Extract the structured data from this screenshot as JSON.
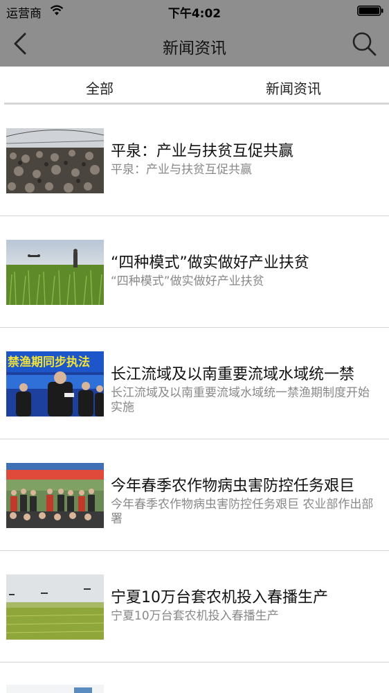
{
  "status_bar": {
    "carrier": "运营商",
    "time": "下午4:02"
  },
  "nav": {
    "title": "新闻资讯",
    "back_icon": "chevron-left-icon",
    "search_icon": "search-icon"
  },
  "tabs": [
    {
      "label": "全部"
    },
    {
      "label": "新闻资讯"
    }
  ],
  "news": [
    {
      "title": "平泉：产业与扶贫互促共赢",
      "summary": "平泉：产业与扶贫互促共赢"
    },
    {
      "title": "“四种模式”做实做好产业扶贫",
      "summary": "“四种模式”做实做好产业扶贫"
    },
    {
      "title": "长江流域及以南重要流域水域统一禁",
      "summary": "长江流域及以南重要流域水域统一禁渔期制度开始实施",
      "thumb_banner": "禁渔期同步执法"
    },
    {
      "title": "今年春季农作物病虫害防控任务艰巨",
      "summary": "今年春季农作物病虫害防控任务艰巨 农业部作出部署"
    },
    {
      "title": "宁夏10万台套农机投入春播生产",
      "summary": "宁夏10万台套农机投入春播生产"
    }
  ]
}
